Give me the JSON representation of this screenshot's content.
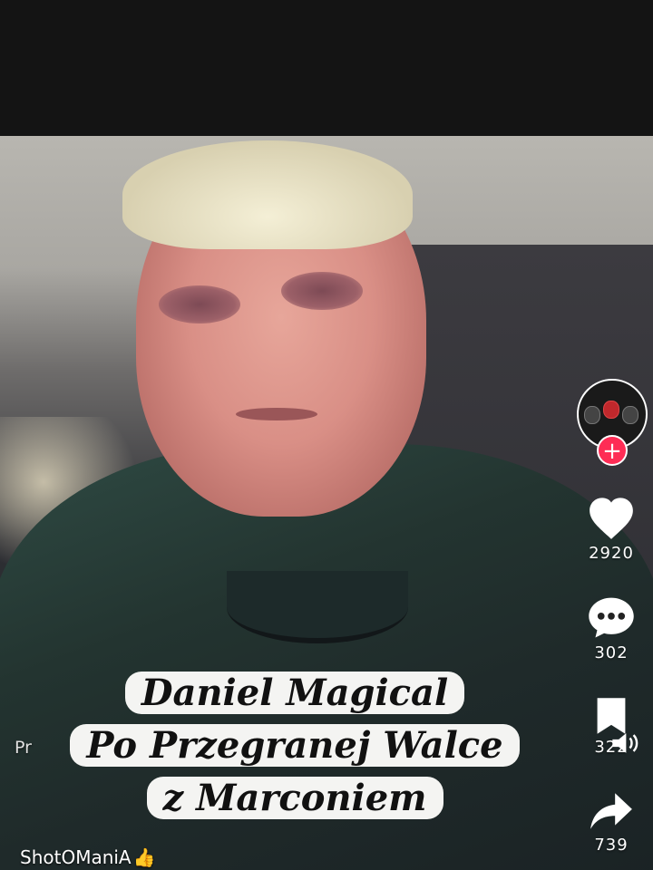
{
  "video": {
    "caption_lines": [
      "Daniel Magical",
      "Po Przegranej Walce",
      "z Marconiem"
    ],
    "description_prefix": "Pr",
    "username": "ShotOManiA",
    "username_emoji": "👍"
  },
  "actions": {
    "follow_symbol": "+",
    "likes": "2920",
    "comments": "302",
    "saves": "322",
    "shares": "739"
  },
  "icons": {
    "like": "heart-icon",
    "comment": "comment-bubble-icon",
    "save": "bookmark-icon",
    "share": "share-arrow-icon",
    "volume": "speaker-icon"
  },
  "colors": {
    "follow_accent": "#fe2c55",
    "caption_background": "#f4f4f2",
    "caption_text": "#111111"
  }
}
